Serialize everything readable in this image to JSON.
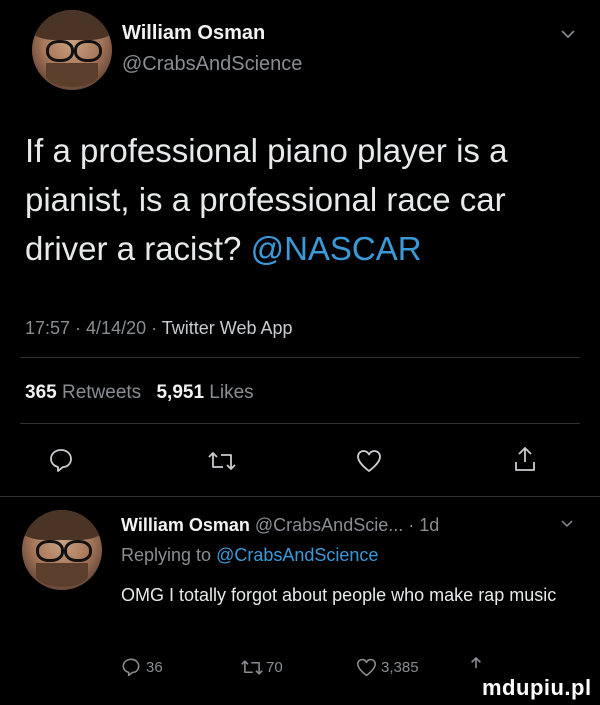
{
  "main_tweet": {
    "author_name": "William Osman",
    "author_handle": "@CrabsAndScience",
    "text_before": "If a professional piano player is a pianist, is a professional race car driver a racist? ",
    "text_mention": "@NASCAR",
    "timestamp": "17:57 · 4/14/20 · ",
    "source": "Twitter Web App",
    "retweets_count": "365",
    "retweets_label": "Retweets",
    "likes_count": "5,951",
    "likes_label": "Likes"
  },
  "reply": {
    "author_name": "William Osman",
    "author_handle": "@CrabsAndScie...",
    "time": "· 1d",
    "replying_prefix": "Replying to ",
    "replying_handle": "@CrabsAndScience",
    "text": "OMG I totally forgot about people who make rap music",
    "reply_count": "36",
    "retweet_count": "70",
    "like_count": "3,385"
  },
  "watermark": "mdupiu.pl",
  "colors": {
    "background": "#000000",
    "text": "#e7e9ea",
    "muted": "#8a8d91",
    "link": "#3a9ad9"
  },
  "icons": [
    "chevron-down-icon",
    "reply-icon",
    "retweet-icon",
    "heart-icon",
    "share-icon"
  ]
}
